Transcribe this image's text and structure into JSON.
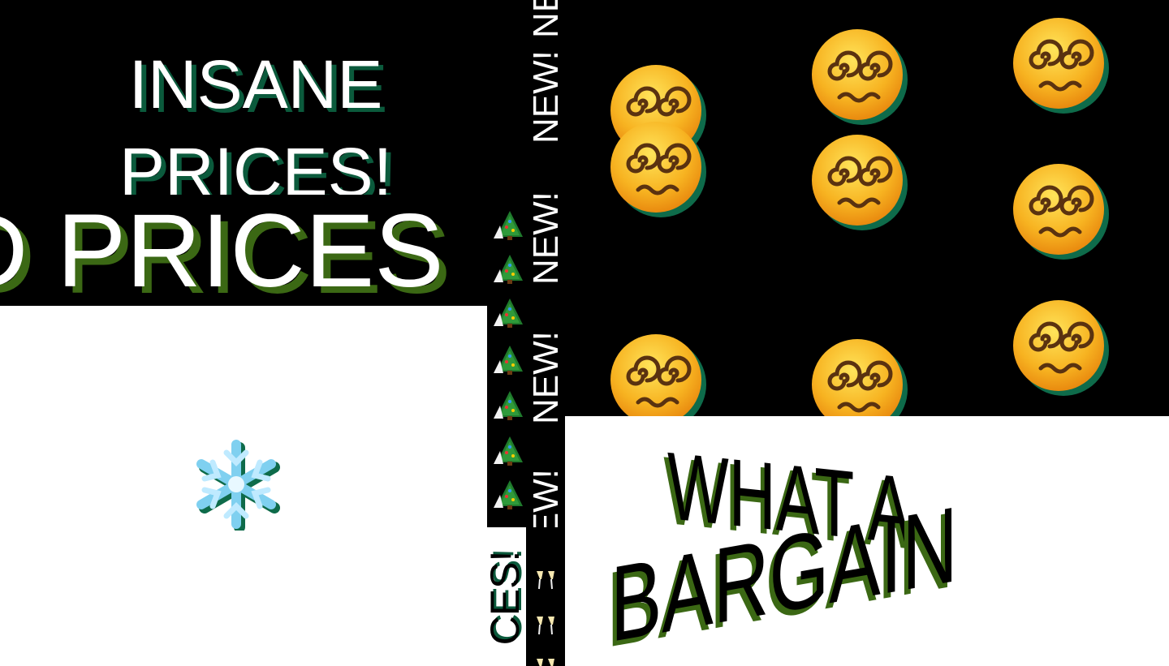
{
  "panels": {
    "insane": {
      "line1": "INSANE",
      "line2": "PRICES!"
    },
    "band": {
      "text": "D PRICES"
    },
    "vertical_new": {
      "word": "NEW!"
    },
    "ces": {
      "text": "CES!"
    },
    "bargain": {
      "line1": "WHAT A",
      "line2": "BARGAIN"
    }
  },
  "icons": {
    "snowflake": "snowflake-icon",
    "tree": "christmas-tree-icon",
    "glasses": "champagne-glasses-icon",
    "face": "dizzy-face-icon"
  },
  "colors": {
    "shadow_green": "#0b5a3c",
    "shadow_olive": "#3b6814",
    "black": "#000000",
    "white": "#ffffff"
  }
}
